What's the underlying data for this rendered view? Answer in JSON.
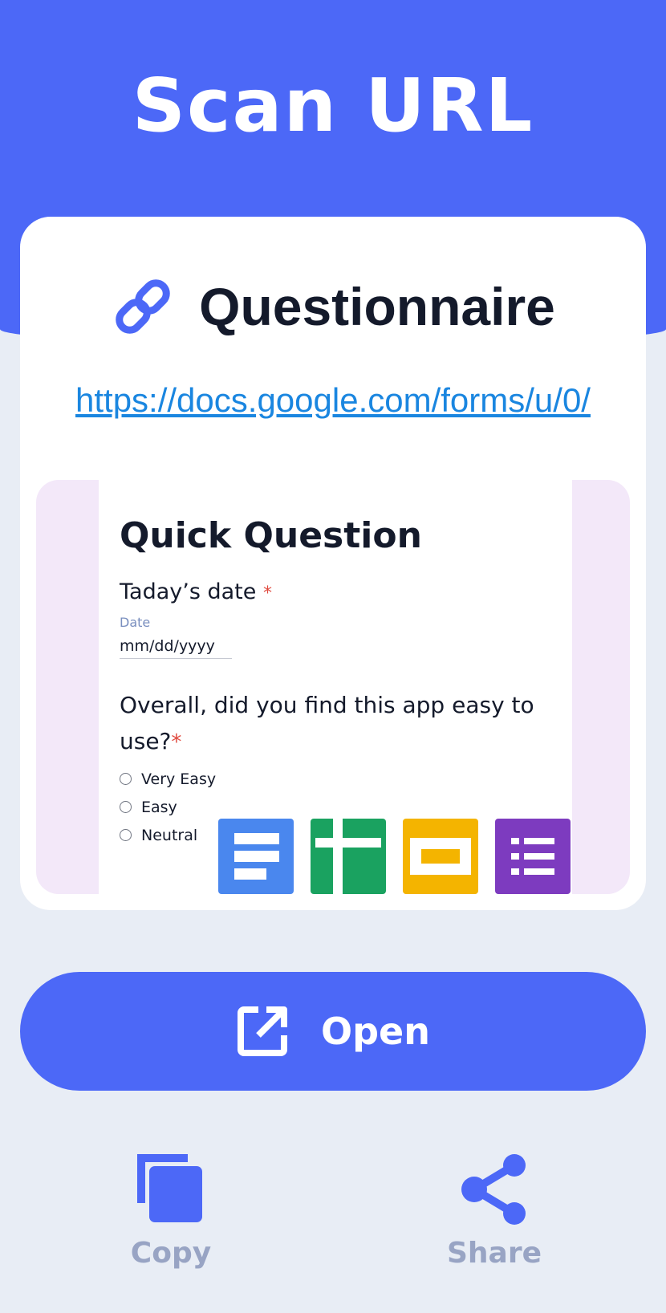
{
  "colors": {
    "accent": "#4c68f7",
    "link": "#1a86e0",
    "background": "#e8edf5",
    "required": "#e04a3f"
  },
  "header": {
    "title": "Scan URL"
  },
  "result": {
    "type_icon": "link-icon",
    "type_label": "Questionnaire",
    "url": "https://docs.google.com/forms/u/0/"
  },
  "preview": {
    "form_title": "Quick Question",
    "question1": {
      "text": "Taday’s date",
      "required_mark": "*",
      "field_label": "Date",
      "placeholder": "mm/dd/yyyy"
    },
    "question2": {
      "text": "Overall, did you find this app easy to use?",
      "required_mark": "*"
    },
    "options": [
      "Very Easy",
      "Easy",
      "Neutral"
    ],
    "app_icons": [
      "docs-icon",
      "sheets-icon",
      "slides-icon",
      "forms-icon"
    ]
  },
  "actions": {
    "open": {
      "label": "Open",
      "icon": "open-external-icon"
    },
    "copy": {
      "label": "Copy",
      "icon": "copy-icon"
    },
    "share": {
      "label": "Share",
      "icon": "share-icon"
    }
  }
}
